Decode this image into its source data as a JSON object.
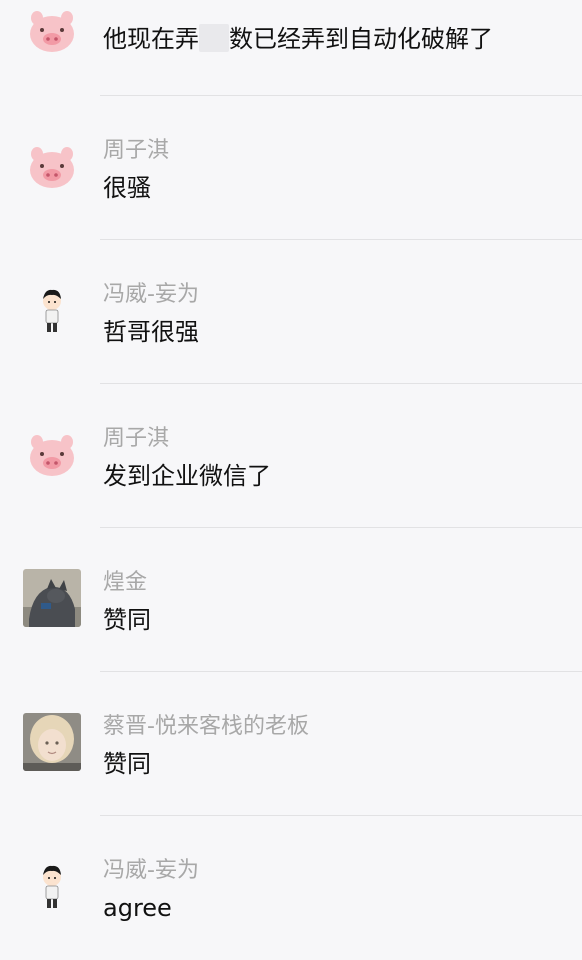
{
  "messages": [
    {
      "avatar": "pig-face-avatar",
      "name": "",
      "text_before": "他现在弄",
      "text_after": "数已经弄到自动化破解了"
    },
    {
      "avatar": "pig-face-avatar",
      "name": "周子淇",
      "text": "很骚"
    },
    {
      "avatar": "cartoon-boy-avatar",
      "name": "冯威-妄为",
      "text": "哲哥很强"
    },
    {
      "avatar": "pig-face-avatar",
      "name": "周子淇",
      "text": "发到企业微信了"
    },
    {
      "avatar": "cat-photo-avatar",
      "name": "煌金",
      "text": "赞同"
    },
    {
      "avatar": "blonde-child-photo-avatar",
      "name": "蔡晋-悦来客栈的老板",
      "text": "赞同"
    },
    {
      "avatar": "cartoon-boy-avatar",
      "name": "冯威-妄为",
      "text": "agree"
    }
  ]
}
